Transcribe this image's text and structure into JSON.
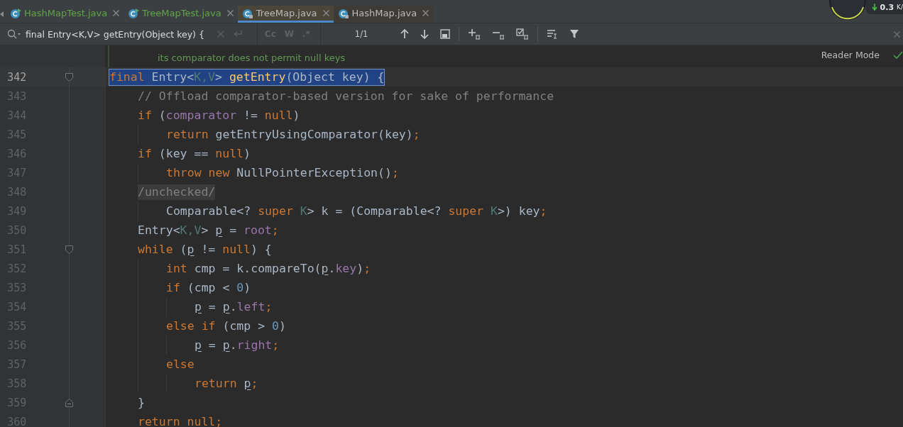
{
  "tabs": [
    {
      "label": "HashMapTest.java",
      "kind": "test",
      "selected": false
    },
    {
      "label": "TreeMapTest.java",
      "kind": "test",
      "selected": false
    },
    {
      "label": "TreeMap.java",
      "kind": "library",
      "selected": true
    },
    {
      "label": "HashMap.java",
      "kind": "library",
      "selected": false
    }
  ],
  "monitor": {
    "speed": "0.3",
    "unit": "K/"
  },
  "search": {
    "value": "final Entry<K,V> getEntry(Object key) {",
    "toggles": [
      {
        "label": "Cc",
        "on": false
      },
      {
        "label": "W",
        "on": false
      },
      {
        "label": ".*",
        "on": false
      }
    ],
    "count": "1/1"
  },
  "doc_comment": "its comparator does not permit null keys",
  "reader_mode": "Reader Mode",
  "lines": [
    {
      "number": "342",
      "selected": true,
      "highlight": false,
      "fold_start": true,
      "fold_end": false,
      "tokens": [
        {
          "text": "final",
          "kind": "keyword"
        },
        {
          "text": " Entry<",
          "kind": "plain"
        },
        {
          "text": "K,V",
          "kind": "typeparam"
        },
        {
          "text": "> ",
          "kind": "plain"
        },
        {
          "text": "getEntry",
          "kind": "method"
        },
        {
          "text": "(Object key) {",
          "kind": "plain"
        }
      ],
      "children": [
        {
          "number": "343",
          "selected": false,
          "highlight": false,
          "fold_start": false,
          "fold_end": false,
          "tokens": [
            {
              "text": "// Offload comparator-based version for sake of performance",
              "kind": "comment"
            }
          ]
        },
        {
          "number": "344",
          "selected": false,
          "highlight": false,
          "fold_start": false,
          "fold_end": false,
          "tokens": [
            {
              "text": "if",
              "kind": "keyword"
            },
            {
              "text": " (",
              "kind": "plain"
            },
            {
              "text": "comparator",
              "kind": "field"
            },
            {
              "text": " != ",
              "kind": "plain"
            },
            {
              "text": "null",
              "kind": "keyword"
            },
            {
              "text": ")",
              "kind": "plain"
            }
          ],
          "children": [
            {
              "number": "345",
              "selected": false,
              "highlight": false,
              "fold_start": false,
              "fold_end": false,
              "tokens": [
                {
                  "text": "return",
                  "kind": "keyword"
                },
                {
                  "text": " getEntryUsingComparator(key)",
                  "kind": "plain"
                },
                {
                  "text": ";",
                  "kind": "keyword"
                }
              ]
            }
          ]
        },
        {
          "number": "346",
          "selected": false,
          "highlight": false,
          "fold_start": false,
          "fold_end": false,
          "tokens": [
            {
              "text": "if",
              "kind": "keyword"
            },
            {
              "text": " (key == ",
              "kind": "plain"
            },
            {
              "text": "null",
              "kind": "keyword"
            },
            {
              "text": ")",
              "kind": "plain"
            }
          ],
          "children": [
            {
              "number": "347",
              "selected": false,
              "highlight": false,
              "fold_start": false,
              "fold_end": false,
              "tokens": [
                {
                  "text": "throw new",
                  "kind": "keyword"
                },
                {
                  "text": " NullPointerException()",
                  "kind": "plain"
                },
                {
                  "text": ";",
                  "kind": "keyword"
                }
              ]
            }
          ]
        },
        {
          "number": "348",
          "selected": false,
          "highlight": true,
          "fold_start": false,
          "fold_end": false,
          "tokens": [
            {
              "text": "/unchecked/",
              "kind": "comment"
            }
          ],
          "children": [
            {
              "number": "349",
              "selected": false,
              "highlight": false,
              "fold_start": false,
              "fold_end": false,
              "tokens": [
                {
                  "text": "Comparable<? ",
                  "kind": "plain"
                },
                {
                  "text": "super",
                  "kind": "keyword"
                },
                {
                  "text": " K",
                  "kind": "typeparam"
                },
                {
                  "text": "> k = (Comparable<? ",
                  "kind": "plain"
                },
                {
                  "text": "super",
                  "kind": "keyword"
                },
                {
                  "text": " K",
                  "kind": "typeparam"
                },
                {
                  "text": ">) key",
                  "kind": "plain"
                },
                {
                  "text": ";",
                  "kind": "keyword"
                }
              ]
            }
          ]
        },
        {
          "number": "350",
          "selected": false,
          "highlight": false,
          "fold_start": false,
          "fold_end": false,
          "tokens": [
            {
              "text": "Entry<",
              "kind": "plain"
            },
            {
              "text": "K,V",
              "kind": "typeparam"
            },
            {
              "text": "> ",
              "kind": "plain"
            },
            {
              "text": "p",
              "kind": "local"
            },
            {
              "text": " = ",
              "kind": "plain"
            },
            {
              "text": "root",
              "kind": "field"
            },
            {
              "text": ";",
              "kind": "keyword"
            }
          ]
        },
        {
          "number": "351",
          "selected": false,
          "highlight": false,
          "fold_start": true,
          "fold_end": false,
          "tokens": [
            {
              "text": "while",
              "kind": "keyword"
            },
            {
              "text": " (",
              "kind": "plain"
            },
            {
              "text": "p",
              "kind": "local"
            },
            {
              "text": " != ",
              "kind": "plain"
            },
            {
              "text": "null",
              "kind": "keyword"
            },
            {
              "text": ") {",
              "kind": "plain"
            }
          ],
          "children": [
            {
              "number": "352",
              "selected": false,
              "highlight": false,
              "fold_start": false,
              "fold_end": false,
              "tokens": [
                {
                  "text": "int",
                  "kind": "keyword"
                },
                {
                  "text": " cmp = k.compareTo(",
                  "kind": "plain"
                },
                {
                  "text": "p",
                  "kind": "local"
                },
                {
                  "text": ".",
                  "kind": "plain"
                },
                {
                  "text": "key",
                  "kind": "field"
                },
                {
                  "text": ")",
                  "kind": "plain"
                },
                {
                  "text": ";",
                  "kind": "keyword"
                }
              ]
            },
            {
              "number": "353",
              "selected": false,
              "highlight": false,
              "fold_start": false,
              "fold_end": false,
              "tokens": [
                {
                  "text": "if",
                  "kind": "keyword"
                },
                {
                  "text": " (cmp < ",
                  "kind": "plain"
                },
                {
                  "text": "0",
                  "kind": "number"
                },
                {
                  "text": ")",
                  "kind": "plain"
                }
              ],
              "children": [
                {
                  "number": "354",
                  "selected": false,
                  "highlight": false,
                  "fold_start": false,
                  "fold_end": false,
                  "tokens": [
                    {
                      "text": "p",
                      "kind": "local"
                    },
                    {
                      "text": " = ",
                      "kind": "plain"
                    },
                    {
                      "text": "p",
                      "kind": "local"
                    },
                    {
                      "text": ".",
                      "kind": "plain"
                    },
                    {
                      "text": "left",
                      "kind": "field"
                    },
                    {
                      "text": ";",
                      "kind": "keyword"
                    }
                  ]
                }
              ]
            },
            {
              "number": "355",
              "selected": false,
              "highlight": false,
              "fold_start": false,
              "fold_end": false,
              "tokens": [
                {
                  "text": "else if",
                  "kind": "keyword"
                },
                {
                  "text": " (cmp > ",
                  "kind": "plain"
                },
                {
                  "text": "0",
                  "kind": "number"
                },
                {
                  "text": ")",
                  "kind": "plain"
                }
              ],
              "children": [
                {
                  "number": "356",
                  "selected": false,
                  "highlight": false,
                  "fold_start": false,
                  "fold_end": false,
                  "tokens": [
                    {
                      "text": "p",
                      "kind": "local"
                    },
                    {
                      "text": " = ",
                      "kind": "plain"
                    },
                    {
                      "text": "p",
                      "kind": "local"
                    },
                    {
                      "text": ".",
                      "kind": "plain"
                    },
                    {
                      "text": "right",
                      "kind": "field"
                    },
                    {
                      "text": ";",
                      "kind": "keyword"
                    }
                  ]
                }
              ]
            },
            {
              "number": "357",
              "selected": false,
              "highlight": false,
              "fold_start": false,
              "fold_end": false,
              "tokens": [
                {
                  "text": "else",
                  "kind": "keyword"
                }
              ],
              "children": [
                {
                  "number": "358",
                  "selected": false,
                  "highlight": false,
                  "fold_start": false,
                  "fold_end": false,
                  "tokens": [
                    {
                      "text": "return ",
                      "kind": "keyword"
                    },
                    {
                      "text": "p",
                      "kind": "local"
                    },
                    {
                      "text": ";",
                      "kind": "keyword"
                    }
                  ]
                }
              ]
            }
          ]
        },
        {
          "number": "359",
          "selected": false,
          "highlight": false,
          "fold_start": false,
          "fold_end": true,
          "tokens": [
            {
              "text": "}",
              "kind": "plain"
            }
          ]
        },
        {
          "number": "360",
          "selected": false,
          "highlight": false,
          "fold_start": false,
          "fold_end": false,
          "tokens": [
            {
              "text": "return null",
              "kind": "keyword"
            },
            {
              "text": ";",
              "kind": "keyword"
            }
          ]
        }
      ]
    }
  ]
}
